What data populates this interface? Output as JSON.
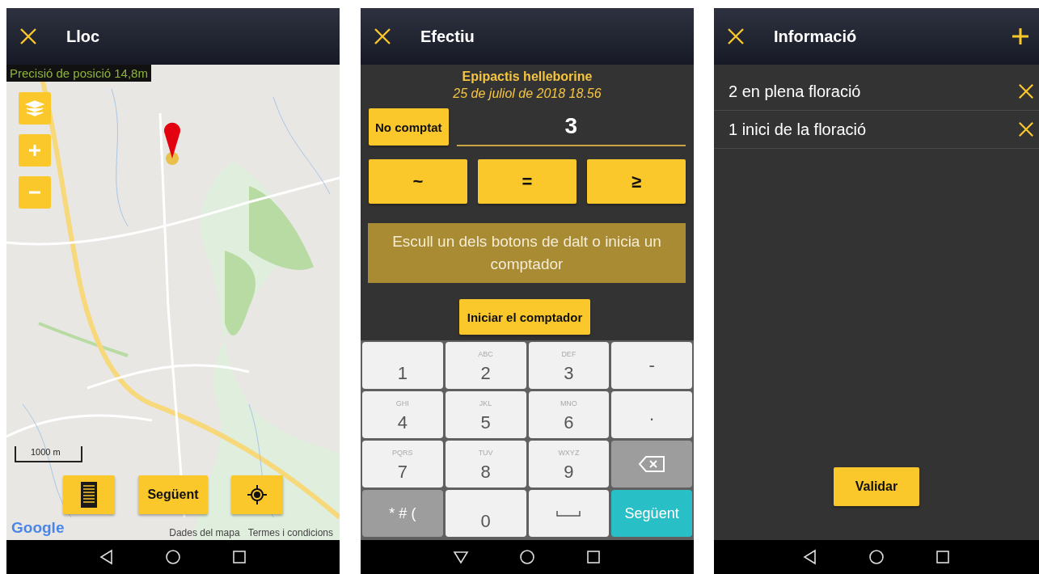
{
  "screens": [
    {
      "kind": "map",
      "title": "Lloc",
      "accuracy": "Precisió de posició 14,8m",
      "scale": "1000 m",
      "next_button": "Següent",
      "attribution": [
        "Dades del mapa",
        "Termes i condicions"
      ],
      "logo": "Google"
    },
    {
      "kind": "count",
      "title": "Efectiu",
      "species": "Epipactis helleborine",
      "date": "25 de juliol de 2018 18.56",
      "not_counted": "No comptat",
      "count_value": "3",
      "qualifiers": [
        "~",
        "=",
        "≥"
      ],
      "message": "Escull un dels botons de dalt o inicia un comptador",
      "start_button": "Iniciar el comptador",
      "keys": [
        {
          "kind": "digit",
          "label": "1"
        },
        {
          "kind": "digit",
          "label": "2",
          "letters": "ABC"
        },
        {
          "kind": "digit",
          "label": "3",
          "letters": "DEF"
        },
        {
          "kind": "symbol",
          "label": "-"
        },
        {
          "kind": "digit",
          "label": "4",
          "letters": "GHI"
        },
        {
          "kind": "digit",
          "label": "5",
          "letters": "JKL"
        },
        {
          "kind": "digit",
          "label": "6",
          "letters": "MNO"
        },
        {
          "kind": "symbol",
          "label": "."
        },
        {
          "kind": "digit",
          "label": "7",
          "letters": "PQRS"
        },
        {
          "kind": "digit",
          "label": "8",
          "letters": "TUV"
        },
        {
          "kind": "digit",
          "label": "9",
          "letters": "WXYZ"
        },
        {
          "kind": "backspace"
        },
        {
          "kind": "special",
          "label": "* # ("
        },
        {
          "kind": "digit",
          "label": "0"
        },
        {
          "kind": "space"
        },
        {
          "kind": "action",
          "label": "Següent"
        }
      ]
    },
    {
      "kind": "info",
      "title": "Informació",
      "items": [
        "2 en plena floració",
        "1 inici de la floració"
      ],
      "validate_button": "Validar"
    }
  ]
}
